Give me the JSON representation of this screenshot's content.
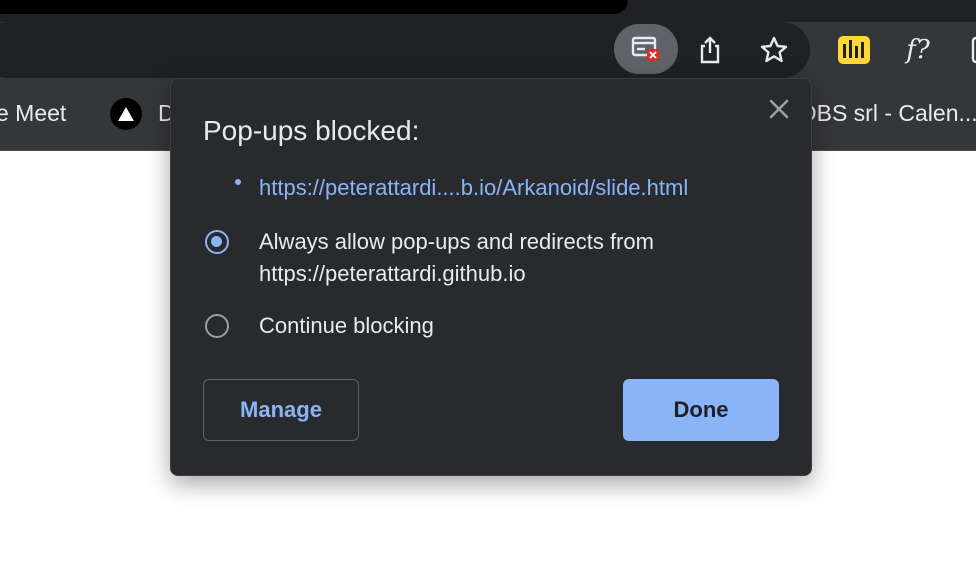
{
  "toolbar": {
    "icons": [
      "popup-blocked-icon",
      "share-icon",
      "bookmark-star-icon",
      "extension-audio-icon",
      "extension-fx-icon",
      "extension-partial-icon"
    ],
    "ext_fx_label": "f?"
  },
  "bookmarks": {
    "item1": "e Meet",
    "item2": "D",
    "item3": "DBS srl - Calen..."
  },
  "dialog": {
    "title": "Pop-ups blocked:",
    "blocked_link": "https://peterattardi....b.io/Arkanoid/slide.html",
    "option_allow_line1": "Always allow pop-ups and redirects from",
    "option_allow_line2": "https://peterattardi.github.io",
    "option_block": "Continue blocking",
    "selected_option": "allow",
    "manage_label": "Manage",
    "done_label": "Done"
  },
  "colors": {
    "accent": "#8ab4f8",
    "dialog_bg": "#292a2d",
    "toolbar_bg": "#35363a",
    "extension_yellow": "#fdd835",
    "badge_red": "#d93025"
  }
}
